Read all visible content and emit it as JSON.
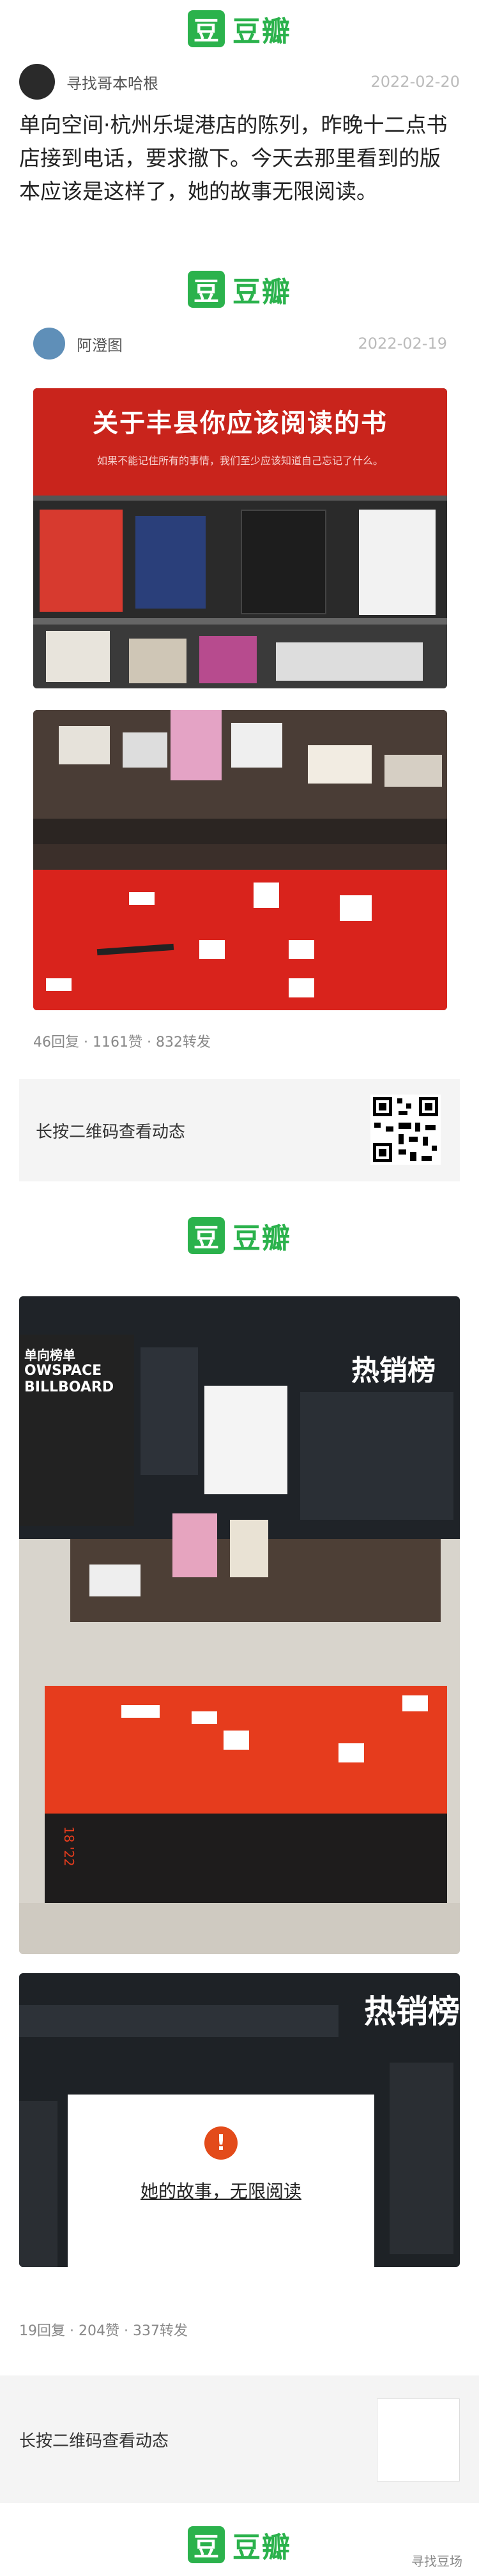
{
  "logo": {
    "mark": "豆",
    "text": "豆瓣"
  },
  "post1": {
    "author": "寻找哥本哈根",
    "date": "2022-02-20",
    "text": "单向空间·杭州乐堤港店的陈列，昨晚十二点书店接到电话，要求撤下。今天去那里看到的版本应该是这样了，她的故事无限阅读。"
  },
  "quoted": {
    "author": "阿澄图",
    "date": "2022-02-19",
    "banner_title": "关于丰县你应该阅读的书",
    "banner_sub": "如果不能记住所有的事情，我们至少应该知道自己忘记了什么。",
    "stats": "46回复 · 1161赞 · 832转发",
    "qr_label": "长按二维码查看动态"
  },
  "photos": {
    "store_sign_title": "单向榜单",
    "store_sign_sub": "OWSPACE BILLBOARD",
    "bestseller_label": "热销榜",
    "table_mark": "18 '22",
    "notice_text": "她的故事，无限阅读"
  },
  "post1_footer": {
    "stats": "19回复 · 204赞 · 337转发",
    "qr_label": "长按二维码查看动态"
  },
  "watermark": "寻找豆场"
}
